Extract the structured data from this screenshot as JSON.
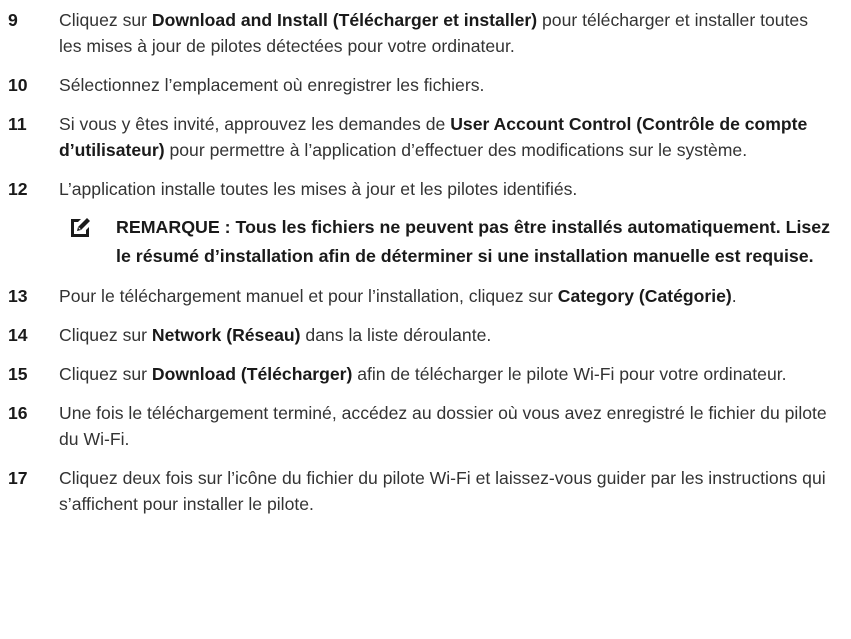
{
  "steps": [
    {
      "num": "9",
      "parts": [
        {
          "t": "Cliquez sur ",
          "b": false
        },
        {
          "t": "Download and Install (Télécharger et installer)",
          "b": true
        },
        {
          "t": " pour télécharger et installer toutes les mises à jour de pilotes détectées pour votre ordinateur.",
          "b": false
        }
      ]
    },
    {
      "num": "10",
      "parts": [
        {
          "t": "Sélectionnez l’emplacement où enregistrer les fichiers.",
          "b": false
        }
      ]
    },
    {
      "num": "11",
      "parts": [
        {
          "t": "Si vous y êtes invité, approuvez les demandes de ",
          "b": false
        },
        {
          "t": "User Account Control (Contrôle de compte d’utilisateur)",
          "b": true
        },
        {
          "t": " pour permettre à l’application d’effectuer des modifications sur le système.",
          "b": false
        }
      ]
    },
    {
      "num": "12",
      "parts": [
        {
          "t": "L’application installe toutes les mises à jour et les pilotes identifiés.",
          "b": false
        }
      ]
    }
  ],
  "note": {
    "icon": "pencil-note-icon",
    "text": "REMARQUE : Tous les fichiers ne peuvent pas être installés automatiquement. Lisez le résumé d’installation afin de déterminer si une installation manuelle est requise."
  },
  "steps2": [
    {
      "num": "13",
      "parts": [
        {
          "t": "Pour le téléchargement manuel et pour l’installation, cliquez sur ",
          "b": false
        },
        {
          "t": "Category (Catégorie)",
          "b": true
        },
        {
          "t": ".",
          "b": false
        }
      ]
    },
    {
      "num": "14",
      "parts": [
        {
          "t": "Cliquez sur ",
          "b": false
        },
        {
          "t": "Network (Réseau)",
          "b": true
        },
        {
          "t": " dans la liste déroulante.",
          "b": false
        }
      ]
    },
    {
      "num": "15",
      "parts": [
        {
          "t": "Cliquez sur ",
          "b": false
        },
        {
          "t": "Download (Télécharger)",
          "b": true
        },
        {
          "t": " afin de télécharger le pilote Wi-Fi pour votre ordinateur.",
          "b": false
        }
      ]
    },
    {
      "num": "16",
      "parts": [
        {
          "t": "Une fois le téléchargement terminé, accédez au dossier où vous avez enregistré le fichier du pilote du Wi-Fi.",
          "b": false
        }
      ]
    },
    {
      "num": "17",
      "parts": [
        {
          "t": "Cliquez deux fois sur l’icône du fichier du pilote Wi-Fi et laissez-vous guider par les instructions qui s’affichent pour installer le pilote.",
          "b": false
        }
      ]
    }
  ]
}
